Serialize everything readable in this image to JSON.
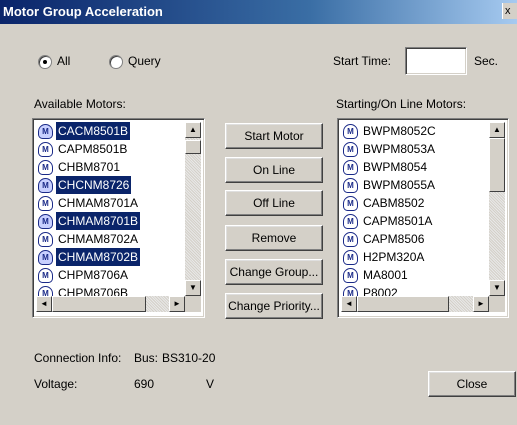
{
  "window": {
    "title": "Motor Group Acceleration",
    "close_glyph": "x"
  },
  "mode": {
    "all_label": "All",
    "query_label": "Query",
    "selected": "All"
  },
  "start_time": {
    "label": "Start Time:",
    "value": "",
    "unit": "Sec."
  },
  "available": {
    "label": "Available Motors:",
    "items": [
      {
        "name": "CACM8501B",
        "selected": true
      },
      {
        "name": "CAPM8501B",
        "selected": false
      },
      {
        "name": "CHBM8701",
        "selected": false
      },
      {
        "name": "CHCNM8726",
        "selected": true
      },
      {
        "name": "CHMAM8701A",
        "selected": false
      },
      {
        "name": "CHMAM8701B",
        "selected": true
      },
      {
        "name": "CHMAM8702A",
        "selected": false
      },
      {
        "name": "CHMAM8702B",
        "selected": true
      },
      {
        "name": "CHPM8706A",
        "selected": false
      },
      {
        "name": "CHPM8706B",
        "selected": false
      }
    ]
  },
  "actions": {
    "start_motor": "Start Motor",
    "on_line": "On Line",
    "off_line": "Off Line",
    "remove": "Remove",
    "change_group": "Change Group...",
    "change_priority": "Change Priority..."
  },
  "starting": {
    "label": "Starting/On Line Motors:",
    "items": [
      {
        "name": "BWPM8052C",
        "selected": false
      },
      {
        "name": "BWPM8053A",
        "selected": false
      },
      {
        "name": "BWPM8054",
        "selected": false
      },
      {
        "name": "BWPM8055A",
        "selected": false
      },
      {
        "name": "CABM8502",
        "selected": false
      },
      {
        "name": "CAPM8501A",
        "selected": false
      },
      {
        "name": "CAPM8506",
        "selected": false
      },
      {
        "name": "H2PM320A",
        "selected": false
      },
      {
        "name": "MA8001",
        "selected": false
      },
      {
        "name": "P8002",
        "selected": false
      }
    ]
  },
  "connection": {
    "label": "Connection Info:",
    "bus_label": "Bus:",
    "bus_value": "BS310-20"
  },
  "voltage": {
    "label": "Voltage:",
    "value": "690",
    "unit": "V"
  },
  "close_button": "Close",
  "icons": {
    "motor": "motor-icon",
    "scroll_up": "▲",
    "scroll_down": "▼",
    "scroll_left": "◄",
    "scroll_right": "►"
  }
}
